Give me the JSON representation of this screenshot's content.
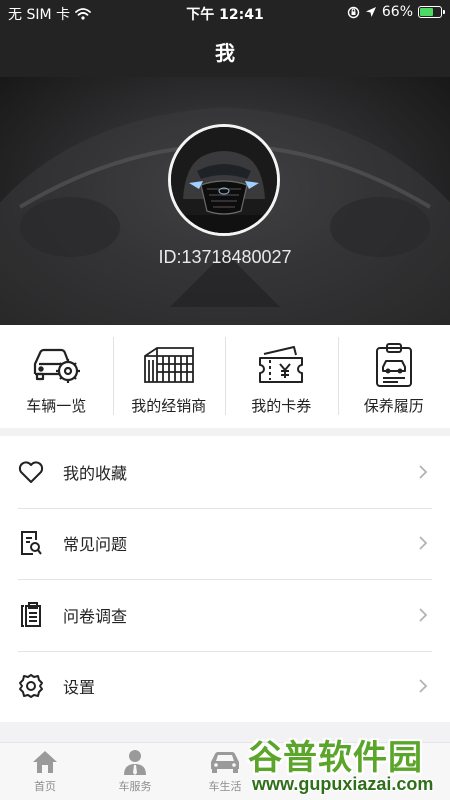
{
  "status_bar": {
    "carrier": "无 SIM 卡",
    "time": "下午 12:41",
    "battery": "66%",
    "battery_level": 0.66,
    "icons": [
      "wifi-icon",
      "orientation-lock-icon",
      "location-arrow-icon",
      "battery-icon"
    ]
  },
  "nav": {
    "title": "我"
  },
  "profile": {
    "user_id": "ID:13718480027",
    "avatar_icon": "car-front-avatar"
  },
  "quick_actions": [
    {
      "label": "车辆一览",
      "icon": "car-gear-icon"
    },
    {
      "label": "我的经销商",
      "icon": "dealer-building-icon"
    },
    {
      "label": "我的卡券",
      "icon": "coupon-ticket-icon"
    },
    {
      "label": "保养履历",
      "icon": "maintenance-clipboard-icon"
    }
  ],
  "menu": [
    {
      "label": "我的收藏",
      "icon": "heart-icon"
    },
    {
      "label": "常见问题",
      "icon": "faq-document-icon"
    },
    {
      "label": "问卷调查",
      "icon": "survey-clipboard-icon"
    },
    {
      "label": "设置",
      "icon": "gear-icon"
    }
  ],
  "tabs": [
    {
      "label": "首页",
      "icon": "home-icon"
    },
    {
      "label": "车服务",
      "icon": "service-person-icon"
    },
    {
      "label": "车生活",
      "icon": "car-icon"
    }
  ],
  "watermark": {
    "text": "谷普软件园",
    "url": "www.gupuxiazai.com"
  },
  "colors": {
    "header_bg": "#232323",
    "accent_battery": "#4cd964",
    "watermark_green": "#5aa52a"
  }
}
